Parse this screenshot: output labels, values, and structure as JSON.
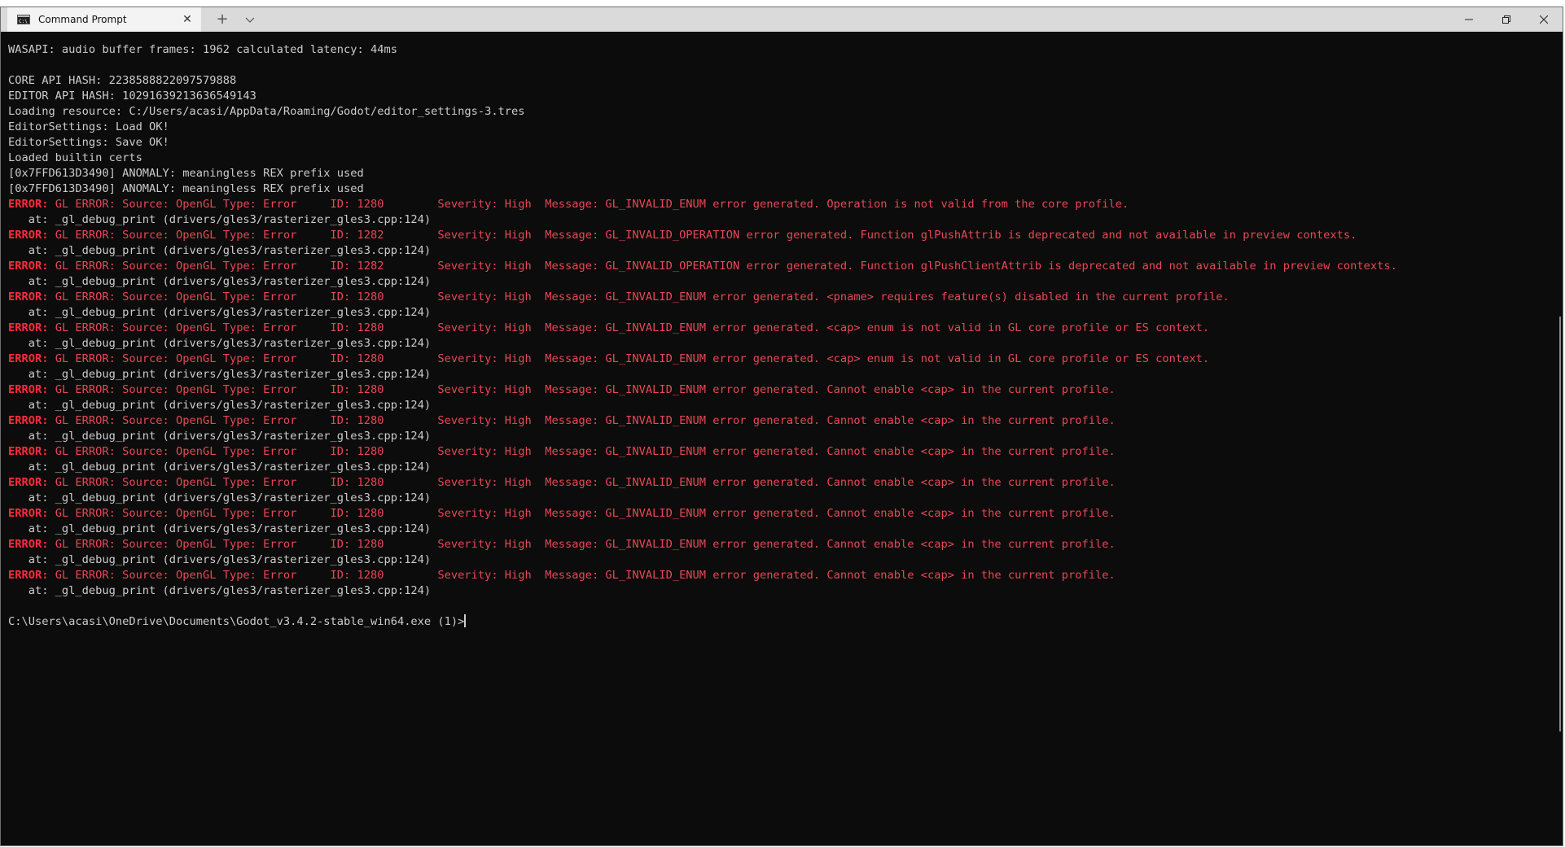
{
  "window": {
    "tab_title": "Command Prompt",
    "close_glyph": "✕",
    "new_tab_glyph": "+",
    "dropdown_glyph": "⌵"
  },
  "console": {
    "lines": [
      {
        "kind": "text",
        "text": "WASAPI: audio buffer frames: 1962 calculated latency: 44ms"
      },
      {
        "kind": "blank",
        "text": ""
      },
      {
        "kind": "text",
        "text": "CORE API HASH: 2238588822097579888"
      },
      {
        "kind": "text",
        "text": "EDITOR API HASH: 10291639213636549143"
      },
      {
        "kind": "text",
        "text": "Loading resource: C:/Users/acasi/AppData/Roaming/Godot/editor_settings-3.tres"
      },
      {
        "kind": "text",
        "text": "EditorSettings: Load OK!"
      },
      {
        "kind": "text",
        "text": "EditorSettings: Save OK!"
      },
      {
        "kind": "text",
        "text": "Loaded builtin certs"
      },
      {
        "kind": "text",
        "text": "[0x7FFD613D3490] ANOMALY: meaningless REX prefix used"
      },
      {
        "kind": "text",
        "text": "[0x7FFD613D3490] ANOMALY: meaningless REX prefix used"
      },
      {
        "kind": "error",
        "label": "ERROR:",
        "text": " GL ERROR: Source: OpenGL Type: Error     ID: 1280        Severity: High  Message: GL_INVALID_ENUM error generated. Operation is not valid from the core profile."
      },
      {
        "kind": "trace",
        "text": "   at: _gl_debug_print (drivers/gles3/rasterizer_gles3.cpp:124)"
      },
      {
        "kind": "error",
        "label": "ERROR:",
        "text": " GL ERROR: Source: OpenGL Type: Error     ID: 1282        Severity: High  Message: GL_INVALID_OPERATION error generated. Function glPushAttrib is deprecated and not available in preview contexts."
      },
      {
        "kind": "trace",
        "text": "   at: _gl_debug_print (drivers/gles3/rasterizer_gles3.cpp:124)"
      },
      {
        "kind": "error",
        "label": "ERROR:",
        "text": " GL ERROR: Source: OpenGL Type: Error     ID: 1282        Severity: High  Message: GL_INVALID_OPERATION error generated. Function glPushClientAttrib is deprecated and not available in preview contexts."
      },
      {
        "kind": "trace",
        "text": "   at: _gl_debug_print (drivers/gles3/rasterizer_gles3.cpp:124)"
      },
      {
        "kind": "error",
        "label": "ERROR:",
        "text": " GL ERROR: Source: OpenGL Type: Error     ID: 1280        Severity: High  Message: GL_INVALID_ENUM error generated. <pname> requires feature(s) disabled in the current profile."
      },
      {
        "kind": "trace",
        "text": "   at: _gl_debug_print (drivers/gles3/rasterizer_gles3.cpp:124)"
      },
      {
        "kind": "error",
        "label": "ERROR:",
        "text": " GL ERROR: Source: OpenGL Type: Error     ID: 1280        Severity: High  Message: GL_INVALID_ENUM error generated. <cap> enum is not valid in GL core profile or ES context."
      },
      {
        "kind": "trace",
        "text": "   at: _gl_debug_print (drivers/gles3/rasterizer_gles3.cpp:124)"
      },
      {
        "kind": "error",
        "label": "ERROR:",
        "text": " GL ERROR: Source: OpenGL Type: Error     ID: 1280        Severity: High  Message: GL_INVALID_ENUM error generated. <cap> enum is not valid in GL core profile or ES context."
      },
      {
        "kind": "trace",
        "text": "   at: _gl_debug_print (drivers/gles3/rasterizer_gles3.cpp:124)"
      },
      {
        "kind": "error",
        "label": "ERROR:",
        "text": " GL ERROR: Source: OpenGL Type: Error     ID: 1280        Severity: High  Message: GL_INVALID_ENUM error generated. Cannot enable <cap> in the current profile."
      },
      {
        "kind": "trace",
        "text": "   at: _gl_debug_print (drivers/gles3/rasterizer_gles3.cpp:124)"
      },
      {
        "kind": "error",
        "label": "ERROR:",
        "text": " GL ERROR: Source: OpenGL Type: Error     ID: 1280        Severity: High  Message: GL_INVALID_ENUM error generated. Cannot enable <cap> in the current profile."
      },
      {
        "kind": "trace",
        "text": "   at: _gl_debug_print (drivers/gles3/rasterizer_gles3.cpp:124)"
      },
      {
        "kind": "error",
        "label": "ERROR:",
        "text": " GL ERROR: Source: OpenGL Type: Error     ID: 1280        Severity: High  Message: GL_INVALID_ENUM error generated. Cannot enable <cap> in the current profile."
      },
      {
        "kind": "trace",
        "text": "   at: _gl_debug_print (drivers/gles3/rasterizer_gles3.cpp:124)"
      },
      {
        "kind": "error",
        "label": "ERROR:",
        "text": " GL ERROR: Source: OpenGL Type: Error     ID: 1280        Severity: High  Message: GL_INVALID_ENUM error generated. Cannot enable <cap> in the current profile."
      },
      {
        "kind": "trace",
        "text": "   at: _gl_debug_print (drivers/gles3/rasterizer_gles3.cpp:124)"
      },
      {
        "kind": "error",
        "label": "ERROR:",
        "text": " GL ERROR: Source: OpenGL Type: Error     ID: 1280        Severity: High  Message: GL_INVALID_ENUM error generated. Cannot enable <cap> in the current profile."
      },
      {
        "kind": "trace",
        "text": "   at: _gl_debug_print (drivers/gles3/rasterizer_gles3.cpp:124)"
      },
      {
        "kind": "error",
        "label": "ERROR:",
        "text": " GL ERROR: Source: OpenGL Type: Error     ID: 1280        Severity: High  Message: GL_INVALID_ENUM error generated. Cannot enable <cap> in the current profile."
      },
      {
        "kind": "trace",
        "text": "   at: _gl_debug_print (drivers/gles3/rasterizer_gles3.cpp:124)"
      },
      {
        "kind": "error",
        "label": "ERROR:",
        "text": " GL ERROR: Source: OpenGL Type: Error     ID: 1280        Severity: High  Message: GL_INVALID_ENUM error generated. Cannot enable <cap> in the current profile."
      },
      {
        "kind": "trace",
        "text": "   at: _gl_debug_print (drivers/gles3/rasterizer_gles3.cpp:124)"
      },
      {
        "kind": "blank",
        "text": ""
      },
      {
        "kind": "prompt",
        "text": "C:\\Users\\acasi\\OneDrive\\Documents\\Godot_v3.4.2-stable_win64.exe (1)>"
      }
    ]
  },
  "colors": {
    "background": "#0c0c0c",
    "foreground": "#cccccc",
    "error": "#e74856",
    "titlebar": "#dadada",
    "active_tab": "#f3f3f3"
  },
  "icons": {
    "tab": "command-prompt-icon",
    "minimize": "minimize-icon",
    "maximize": "restore-icon",
    "close": "close-icon"
  }
}
